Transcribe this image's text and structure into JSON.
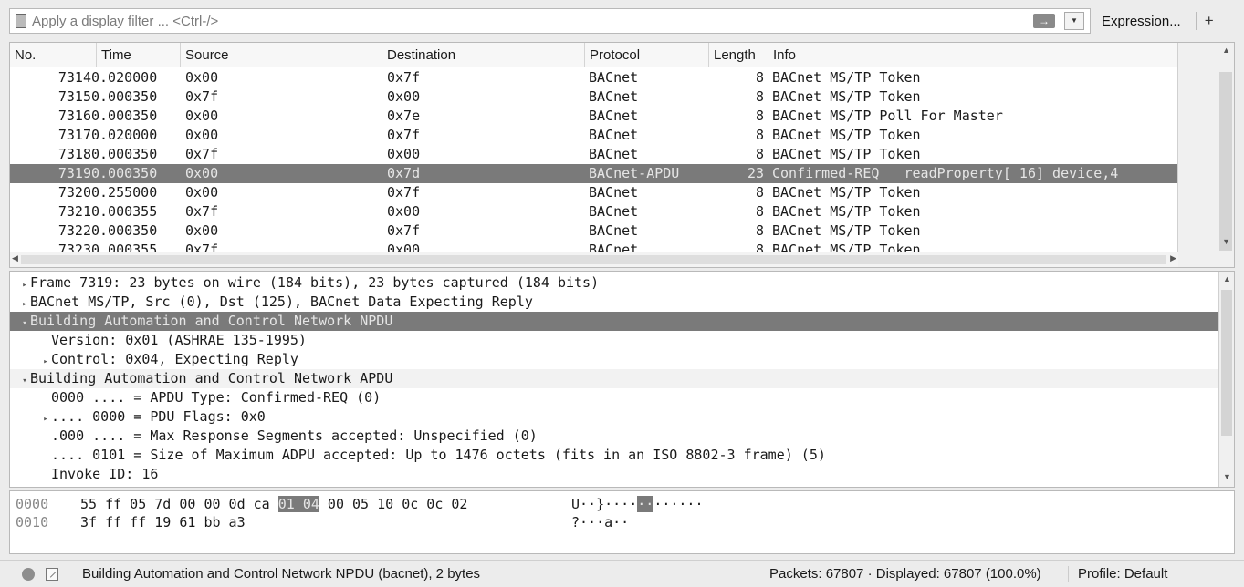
{
  "filter": {
    "placeholder": "Apply a display filter ... <Ctrl-/>",
    "apply_icon": "arrow-right-icon",
    "expression_label": "Expression...",
    "add_label": "+"
  },
  "packet_list": {
    "columns": [
      "No.",
      "Time",
      "Source",
      "Destination",
      "Protocol",
      "Length",
      "Info"
    ],
    "rows": [
      {
        "no": "7314",
        "time": "0.020000",
        "src": "0x00",
        "dst": "0x7f",
        "proto": "BACnet",
        "len": "8",
        "info": "BACnet MS/TP Token"
      },
      {
        "no": "7315",
        "time": "0.000350",
        "src": "0x7f",
        "dst": "0x00",
        "proto": "BACnet",
        "len": "8",
        "info": "BACnet MS/TP Token"
      },
      {
        "no": "7316",
        "time": "0.000350",
        "src": "0x00",
        "dst": "0x7e",
        "proto": "BACnet",
        "len": "8",
        "info": "BACnet MS/TP Poll For Master"
      },
      {
        "no": "7317",
        "time": "0.020000",
        "src": "0x00",
        "dst": "0x7f",
        "proto": "BACnet",
        "len": "8",
        "info": "BACnet MS/TP Token"
      },
      {
        "no": "7318",
        "time": "0.000350",
        "src": "0x7f",
        "dst": "0x00",
        "proto": "BACnet",
        "len": "8",
        "info": "BACnet MS/TP Token"
      },
      {
        "no": "7319",
        "time": "0.000350",
        "src": "0x00",
        "dst": "0x7d",
        "proto": "BACnet-APDU",
        "len": "23",
        "info": "Confirmed-REQ   readProperty[ 16] device,4"
      },
      {
        "no": "7320",
        "time": "0.255000",
        "src": "0x00",
        "dst": "0x7f",
        "proto": "BACnet",
        "len": "8",
        "info": "BACnet MS/TP Token"
      },
      {
        "no": "7321",
        "time": "0.000355",
        "src": "0x7f",
        "dst": "0x00",
        "proto": "BACnet",
        "len": "8",
        "info": "BACnet MS/TP Token"
      },
      {
        "no": "7322",
        "time": "0.000350",
        "src": "0x00",
        "dst": "0x7f",
        "proto": "BACnet",
        "len": "8",
        "info": "BACnet MS/TP Token"
      },
      {
        "no": "7323",
        "time": "0.000355",
        "src": "0x7f",
        "dst": "0x00",
        "proto": "BACnet",
        "len": "8",
        "info": "BACnet MS/TP Token"
      }
    ],
    "selected_row": 5
  },
  "details": {
    "rows": [
      {
        "indent": 0,
        "expander": "collapsed",
        "text": "Frame 7319: 23 bytes on wire (184 bits), 23 bytes captured (184 bits)"
      },
      {
        "indent": 0,
        "expander": "collapsed",
        "text": "BACnet MS/TP, Src (0), Dst (125), BACnet Data Expecting Reply"
      },
      {
        "indent": 0,
        "expander": "expanded",
        "text": "Building Automation and Control Network NPDU",
        "selected": true
      },
      {
        "indent": 1,
        "expander": "none",
        "text": "Version: 0x01 (ASHRAE 135-1995)"
      },
      {
        "indent": 1,
        "expander": "collapsed",
        "text": "Control: 0x04, Expecting Reply"
      },
      {
        "indent": 0,
        "expander": "expanded",
        "text": "Building Automation and Control Network APDU",
        "hover": true
      },
      {
        "indent": 1,
        "expander": "none",
        "text": "0000 .... = APDU Type: Confirmed-REQ (0)"
      },
      {
        "indent": 1,
        "expander": "collapsed",
        "text": ".... 0000 = PDU Flags: 0x0"
      },
      {
        "indent": 1,
        "expander": "none",
        "text": ".000 .... = Max Response Segments accepted: Unspecified (0)"
      },
      {
        "indent": 1,
        "expander": "none",
        "text": ".... 0101 = Size of Maximum ADPU accepted: Up to 1476 octets (fits in an ISO 8802-3 frame) (5)"
      },
      {
        "indent": 1,
        "expander": "none",
        "text": "Invoke ID: 16"
      }
    ]
  },
  "bytes": {
    "rows": [
      {
        "offset": "0000",
        "hex_pre": "55 ff 05 7d 00 00 0d ca ",
        "hex_hl": "01 04",
        "hex_post": " 00 05 10 0c 0c 02",
        "ascii_pre": "U··}····",
        "ascii_hl": "··",
        "ascii_post": "······"
      },
      {
        "offset": "0010",
        "hex_pre": "3f ff ff 19 61 bb a3",
        "hex_hl": "",
        "hex_post": "",
        "ascii_pre": "?···a··",
        "ascii_hl": "",
        "ascii_post": ""
      }
    ]
  },
  "status": {
    "expert_icon": "expert-info-circle-icon",
    "comment_icon": "capture-comment-icon",
    "text": "Building Automation and Control Network NPDU (bacnet), 2 bytes",
    "packets": "Packets: 67807 · Displayed: 67807 (100.0%)",
    "profile": "Profile: Default"
  }
}
